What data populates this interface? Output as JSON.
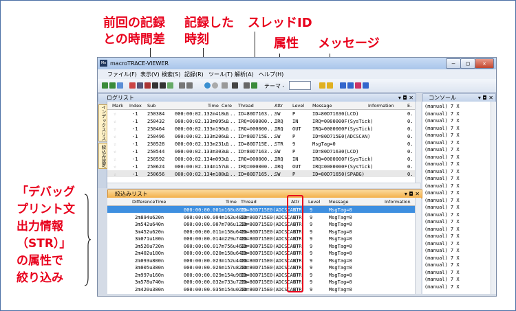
{
  "annotations": {
    "prev_record_diff": [
      "前回の記録",
      "との時間差"
    ],
    "record_time": [
      "記録した",
      "時刻"
    ],
    "thread_id": "スレッドID",
    "attribute": "属性",
    "message": "メッセージ",
    "filter_note": [
      "「デバッグ",
      "プリント文",
      "出力情報",
      "（STR）」",
      "の属性で",
      "絞り込み"
    ]
  },
  "window": {
    "app_icon": "Mo",
    "title": "macroTRACE-VIEWER",
    "min": "–",
    "max": "□",
    "close": "✕"
  },
  "menu": [
    "ファイル(F)",
    "表示(V)",
    "検索(S)",
    "記録(R)",
    "ツール(T)",
    "解析(A)",
    "ヘルプ(H)"
  ],
  "toolbar": {
    "theme_label": "テーマ -"
  },
  "log_panel": {
    "title": "ログリスト",
    "buttons": "▾ ◘ ✕",
    "side_tabs": [
      "インデックスリスト",
      "絞込み設定"
    ],
    "columns": [
      "Mark",
      "Index",
      "Sub",
      "Time",
      "Core",
      "Thread",
      "Attr",
      "Level",
      "Message",
      "Information",
      "E."
    ],
    "rows": [
      {
        "mark": "☆",
        "index": "-1",
        "sub": "250384",
        "time": "000:00:02.132m418u...",
        "core": "0",
        "thread": "ID=80D7163...",
        "attr": "SW",
        "level": "P",
        "message": "ID=80D71630(LCD)",
        "e": "0."
      },
      {
        "mark": "☆",
        "index": "-1",
        "sub": "250432",
        "time": "000:00:02.133m095u...",
        "core": "0",
        "thread": "IRQ=000000...",
        "attr": "IRQ",
        "level": "IN",
        "message": "IRQ=0000000F(SysTick)",
        "e": "0."
      },
      {
        "mark": "☆",
        "index": "-1",
        "sub": "250464",
        "time": "000:00:02.133m196u...",
        "core": "0",
        "thread": "IRQ=000000...",
        "attr": "IRQ",
        "level": "OUT",
        "message": "IRQ=0000000F(SysTick)",
        "e": "0."
      },
      {
        "mark": "☆",
        "index": "-1",
        "sub": "250496",
        "time": "000:00:02.133m206u...",
        "core": "0",
        "thread": "ID=80D715E...",
        "attr": "SW",
        "level": "P",
        "message": "ID=80D715E0(ADCSCAN)",
        "e": "0."
      },
      {
        "mark": "☆",
        "index": "-1",
        "sub": "250528",
        "time": "000:00:02.133m231u...",
        "core": "0",
        "thread": "ID=80D715E...",
        "attr": "STR",
        "level": "9",
        "message": "MsgTag=0",
        "e": "0."
      },
      {
        "mark": "☆",
        "index": "-1",
        "sub": "250544",
        "time": "000:00:02.133m303u...",
        "core": "0",
        "thread": "ID=80D7163...",
        "attr": "SW",
        "level": "P",
        "message": "ID=80D71630(LCD)",
        "e": "0."
      },
      {
        "mark": "☆",
        "index": "-1",
        "sub": "250592",
        "time": "000:00:02.134m093u...",
        "core": "0",
        "thread": "IRQ=000000...",
        "attr": "IRQ",
        "level": "IN",
        "message": "IRQ=0000000F(SysTick)",
        "e": "0."
      },
      {
        "mark": "☆",
        "index": "-1",
        "sub": "250624",
        "time": "000:00:02.134m157u...",
        "core": "0",
        "thread": "IRQ=000000...",
        "attr": "IRQ",
        "level": "OUT",
        "message": "IRQ=0000000F(SysTick)",
        "e": "0."
      },
      {
        "mark": "☆",
        "index": "-1",
        "sub": "250656",
        "time": "000:00:02.134m188u...",
        "core": "0",
        "thread": "ID=80D7165...",
        "attr": "SW",
        "level": "P",
        "message": "ID=80D71650(SPABG)",
        "e": "0."
      }
    ]
  },
  "filter_panel": {
    "title": "絞込みリスト",
    "buttons": "▾ ◘ ✕",
    "columns": [
      "DifferenceTime",
      "Time",
      "Thread",
      "Attr",
      "Level",
      "Message",
      "Information"
    ],
    "rows": [
      {
        "diff": "",
        "time": "000:00:00.001m168u860n",
        "thread": "ID=80D715E0(ADCSCAN)",
        "attr": "STR",
        "level": "9",
        "message": "MsgTag=0"
      },
      {
        "diff": "2m894u620n",
        "time": "000:00:00.004m163u480n",
        "thread": "ID=80D715E0(ADCSCAN)",
        "attr": "STR",
        "level": "9",
        "message": "MsgTag=0"
      },
      {
        "diff": "3m542u640n",
        "time": "000:00:00.007m706u120n",
        "thread": "ID=80D715E0(ADCSCAN)",
        "attr": "STR",
        "level": "9",
        "message": "MsgTag=0"
      },
      {
        "diff": "3m452u620n",
        "time": "000:00:00.011m158u640n",
        "thread": "ID=80D715E0(ADCSCAN)",
        "attr": "STR",
        "level": "9",
        "message": "MsgTag=0"
      },
      {
        "diff": "3m071u100n",
        "time": "000:00:00.014m229u740n",
        "thread": "ID=80D715E0(ADCSCAN)",
        "attr": "STR",
        "level": "9",
        "message": "MsgTag=0"
      },
      {
        "diff": "3m526u720n",
        "time": "000:00:00.017m756u460n",
        "thread": "ID=80D715E0(ADCSCAN)",
        "attr": "STR",
        "level": "9",
        "message": "MsgTag=0"
      },
      {
        "diff": "2m402u180n",
        "time": "000:00:00.020m158u640n",
        "thread": "ID=80D715E0(ADCSCAN)",
        "attr": "STR",
        "level": "9",
        "message": "MsgTag=0"
      },
      {
        "diff": "2m093u800n",
        "time": "000:00:00.023m152u440n",
        "thread": "ID=80D715E0(ADCSCAN)",
        "attr": "STR",
        "level": "9",
        "message": "MsgTag=0"
      },
      {
        "diff": "3m005u380n",
        "time": "000:00:00.026m157u820n",
        "thread": "ID=80D715E0(ADCSCAN)",
        "attr": "STR",
        "level": "9",
        "message": "MsgTag=0"
      },
      {
        "diff": "2m997u160n",
        "time": "000:00:00.029m154u980n",
        "thread": "ID=80D715E0(ADCSCAN)",
        "attr": "STR",
        "level": "9",
        "message": "MsgTag=0"
      },
      {
        "diff": "3m578u740n",
        "time": "000:00:00.032m733u720n",
        "thread": "ID=80D715E0(ADCSCAN)",
        "attr": "STR",
        "level": "9",
        "message": "MsgTag=0"
      },
      {
        "diff": "2m420u380n",
        "time": "000:00:00.035m154u020n",
        "thread": "ID=80D715E0(ADCSCAN)",
        "attr": "STR",
        "level": "9",
        "message": "MsgTag=0"
      }
    ]
  },
  "console": {
    "title": "コンソール",
    "buttons": "▾ ◘ ✕",
    "line": "(manual) 7 X"
  },
  "colors": {
    "annotation": "#e8001c",
    "selection": "#3e8fe0",
    "filter_header": "#f3b04a"
  }
}
